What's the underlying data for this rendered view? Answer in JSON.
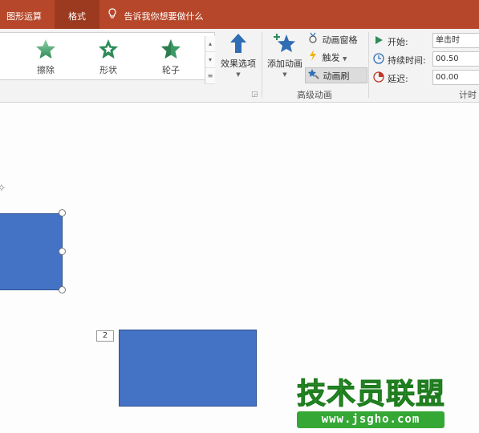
{
  "tabs": {
    "shape_ops": "图形运算",
    "format": "格式",
    "tell_me": "告诉我你想要做什么"
  },
  "animations_gallery": {
    "items": [
      {
        "label": "擦除"
      },
      {
        "label": "形状"
      },
      {
        "label": "轮子"
      }
    ]
  },
  "ribbon": {
    "effect_options": "效果选项",
    "add_animation": "添加动画",
    "animation_pane": "动画窗格",
    "trigger": "触发",
    "animation_painter": "动画刷",
    "advanced_group": "高级动画",
    "timing_group": "计时"
  },
  "timing": {
    "start_label": "开始:",
    "start_value": "单击时",
    "duration_label": "持续时间:",
    "duration_value": "00.50",
    "delay_label": "延迟:",
    "delay_value": "00.00"
  },
  "slide": {
    "sequence_number": "2"
  },
  "watermark": {
    "title": "技术员联盟",
    "url": "www.jsgho.com"
  },
  "colors": {
    "tab_bar": "#b7472a",
    "shape_fill": "#4472c4",
    "watermark_green": "#2e9d2e"
  }
}
